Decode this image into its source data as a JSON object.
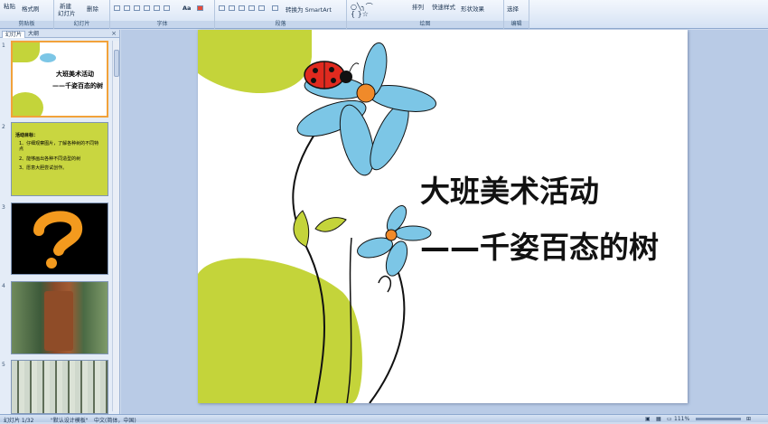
{
  "ribbon": {
    "clipboard": {
      "paste": "粘贴",
      "format_painter": "格式刷",
      "label": "剪贴板"
    },
    "slides": {
      "new_slide": "新建",
      "new_slide_2": "幻灯片",
      "delete": "删除",
      "label": "幻灯片"
    },
    "font": {
      "label": "字体",
      "font_color_btn": "Aa"
    },
    "paragraph": {
      "label": "段落",
      "smartart": "转换为 SmartArt"
    },
    "drawing": {
      "arrange": "排列",
      "quick_styles": "快速样式",
      "shape_effects": "形状效果",
      "label": "绘图"
    },
    "editing": {
      "select": "选择",
      "label": "编辑"
    }
  },
  "panel": {
    "tab_slides": "幻灯片",
    "tab_outline": "大纲",
    "close": "×",
    "thumbs": [
      {
        "num": "1",
        "title": "大班美术活动",
        "subtitle": "——千姿百态的树"
      },
      {
        "num": "2",
        "heading": "活动目标：",
        "lines": [
          "1、仔细观察图片，了解各种树的不同特点",
          "2、能够画出各种不同造型的树",
          "3、愿意大胆尝试创作。"
        ]
      },
      {
        "num": "3"
      },
      {
        "num": "4"
      },
      {
        "num": "5"
      }
    ]
  },
  "slide": {
    "title": "大班美术活动",
    "subtitle": "——千姿百态的树"
  },
  "status": {
    "slide_count": "幻灯片 1/32",
    "theme": "\"默认设计模板\"",
    "language": "中文(简体，中国)",
    "zoom": "111%"
  },
  "colors": {
    "accent_green": "#c4d43a",
    "petal_blue": "#7cc6e6",
    "ladybug_red": "#e02a1f",
    "selection_orange": "#f2a23a"
  }
}
